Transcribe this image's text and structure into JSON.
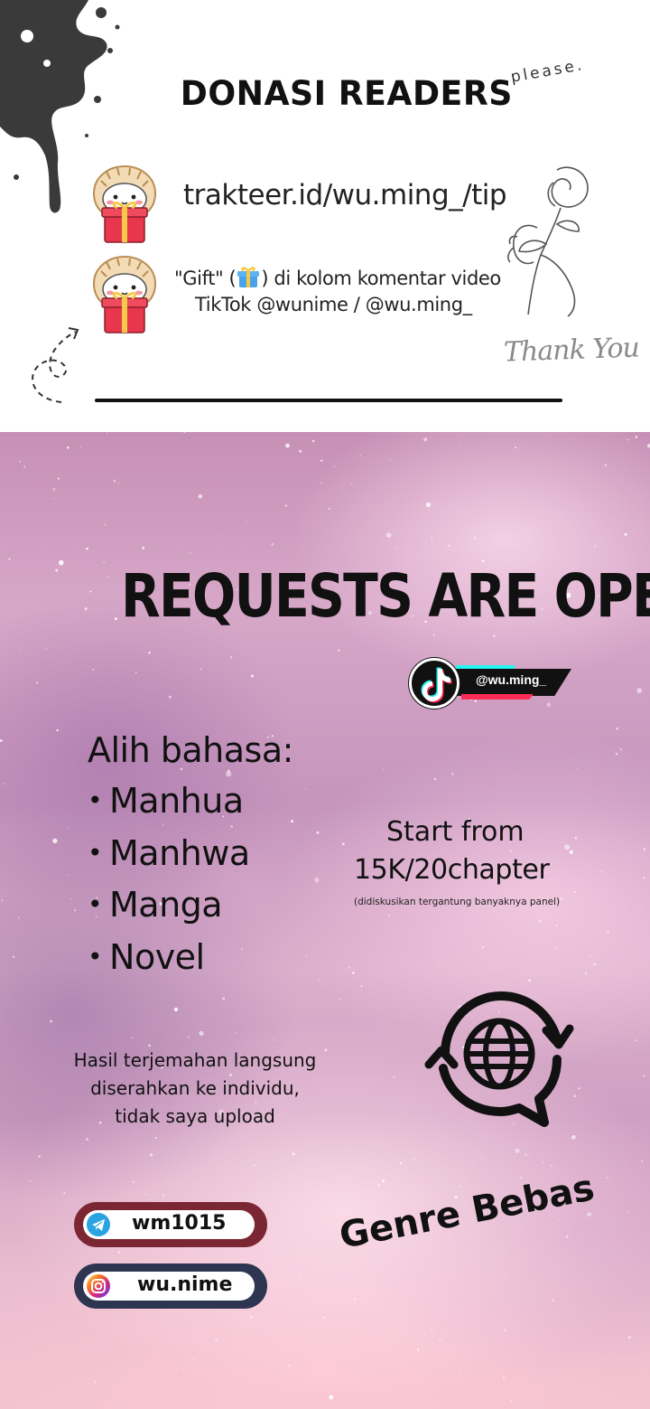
{
  "top": {
    "title": "DONASI READERS",
    "please": "please.",
    "trakteer_url": "trakteer.id/wu.ming_/tip",
    "gift_prefix": "\"Gift\" (",
    "gift_suffix": ") di kolom komentar video",
    "gift_line2": "TikTok @wunime / @wu.ming_",
    "thank_you": "Thank You"
  },
  "bottom": {
    "headline": "REQUESTS ARE OPEN!",
    "tiktok_handle": "@wu.ming_",
    "alih_title": "Alih bahasa:",
    "types": [
      "Manhua",
      "Manhwa",
      "Manga",
      "Novel"
    ],
    "start_line1": "Start from",
    "start_line2": "15K/20chapter",
    "start_note": "(didiskusikan tergantung banyaknya panel)",
    "hasil": [
      "Hasil terjemahan langsung",
      "diserahkan ke individu,",
      "tidak saya upload"
    ],
    "telegram_handle": "wm1015",
    "instagram_handle": "wu.nime",
    "genre": "Genre Bebas"
  },
  "colors": {
    "ink": "#111111",
    "telegram_blue": "#2aa3e0",
    "pill_red": "#7b2733",
    "pill_navy": "#2d3550",
    "tiktok_cyan": "#25f4ee",
    "tiktok_red": "#fe2c55"
  }
}
